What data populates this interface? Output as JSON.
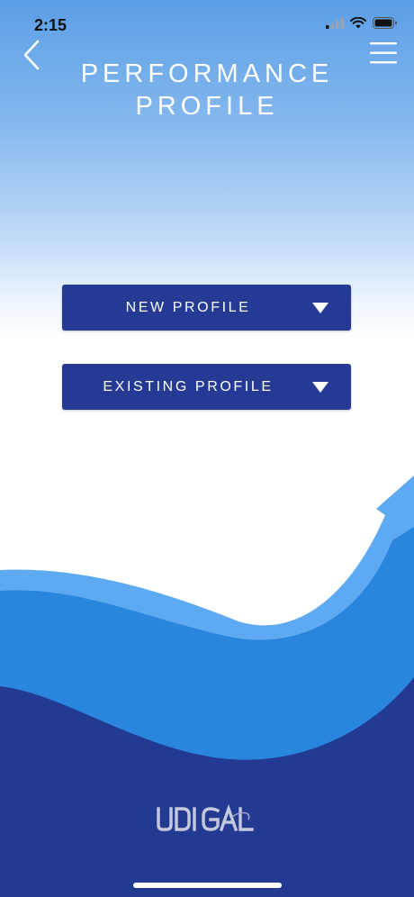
{
  "status_bar": {
    "time": "2:15",
    "icons": [
      "cellular-signal-icon",
      "wifi-icon",
      "battery-icon"
    ]
  },
  "nav": {
    "back_icon": "chevron-left-icon",
    "menu_icon": "hamburger-menu-icon"
  },
  "title": {
    "line1": "PERFORMANCE",
    "line2": "PROFILE"
  },
  "dropdowns": [
    {
      "label": "NEW PROFILE",
      "icon": "caret-down-icon"
    },
    {
      "label": "EXISTING PROFILE",
      "icon": "caret-down-icon"
    }
  ],
  "brand": {
    "logo_text": "UDI GAL"
  },
  "colors": {
    "button_bg": "#253a94",
    "wave_light": "#5eaaf2",
    "wave_mid": "#2a86dd",
    "wave_dark": "#233a92",
    "sky_top": "#5b9fe6"
  }
}
